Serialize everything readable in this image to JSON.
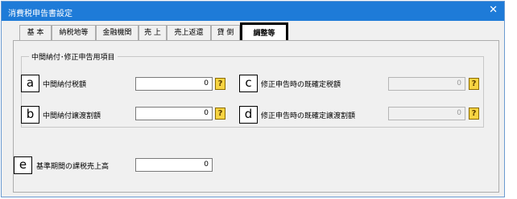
{
  "window": {
    "title": "消費税申告書設定",
    "close_glyph": "✕"
  },
  "tabs": [
    {
      "label": "基 本"
    },
    {
      "label": "納税地等"
    },
    {
      "label": "金融機関"
    },
    {
      "label": "売 上"
    },
    {
      "label": "売上返還"
    },
    {
      "label": "貸 倒"
    },
    {
      "label": "調整等",
      "active": true
    }
  ],
  "group": {
    "title": "中間納付･修正申告用項目"
  },
  "fields": {
    "a": {
      "marker": "a",
      "label": "中間納付税額",
      "value": "0",
      "enabled": true
    },
    "b": {
      "marker": "b",
      "label": "中間納付譲渡割額",
      "value": "0",
      "enabled": true
    },
    "c": {
      "marker": "c",
      "label": "修正申告時の既確定税額",
      "value": "0",
      "enabled": false
    },
    "d": {
      "marker": "d",
      "label": "修正申告時の既確定譲渡割額",
      "value": "0",
      "enabled": false
    },
    "e": {
      "marker": "e",
      "label": "基準期間の課税売上高",
      "value": "0",
      "enabled": true
    }
  },
  "help_glyph": "?",
  "icons": {
    "help": "help-icon",
    "close": "close-icon"
  },
  "colors": {
    "titlebar": "#1e7bd8",
    "help_icon": "#f7d442",
    "window_bg": "#f0f0f0"
  }
}
